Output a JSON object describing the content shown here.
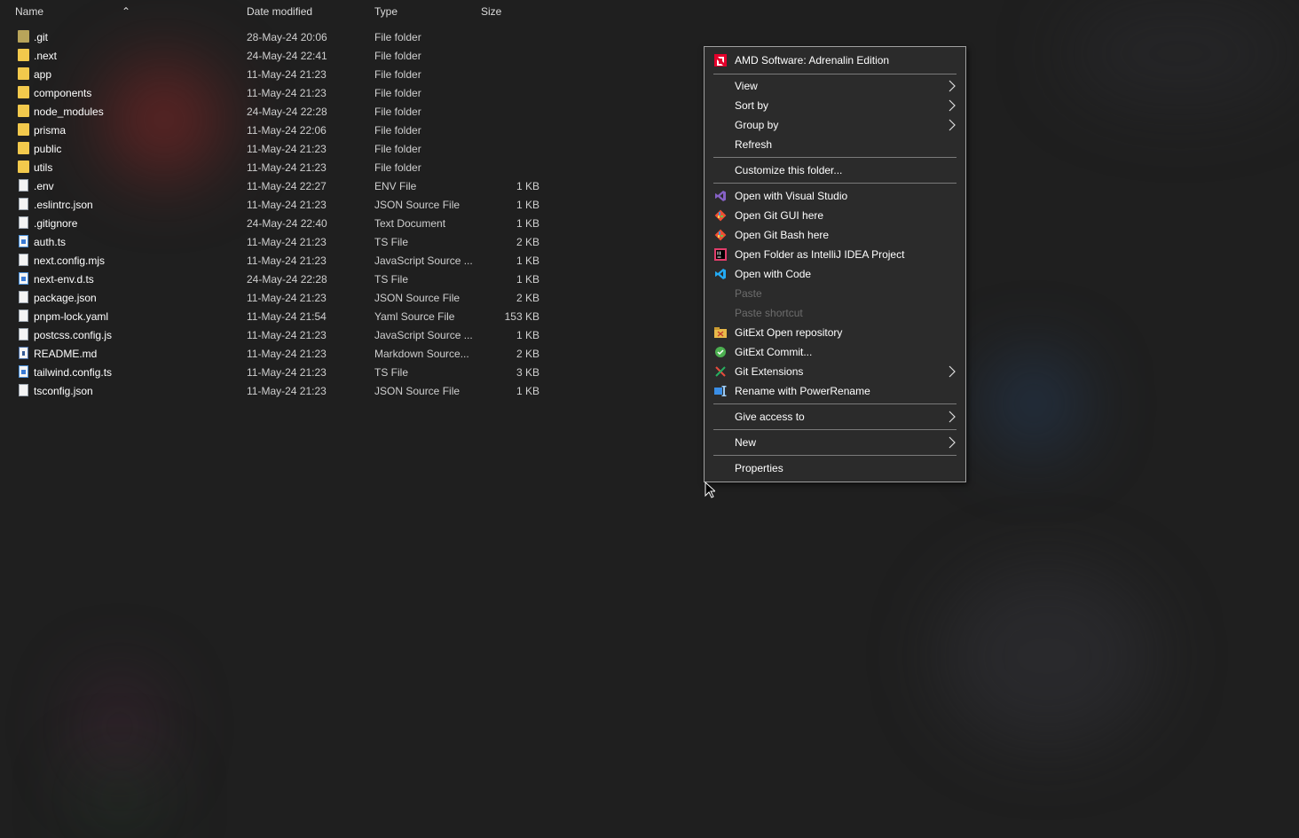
{
  "columns": {
    "name": "Name",
    "date": "Date modified",
    "type": "Type",
    "size": "Size"
  },
  "files": [
    {
      "name": ".git",
      "date": "28-May-24 20:06",
      "type": "File folder",
      "size": "",
      "icon": "folder-icon"
    },
    {
      "name": ".next",
      "date": "24-May-24 22:41",
      "type": "File folder",
      "size": "",
      "icon": "folder-icon"
    },
    {
      "name": "app",
      "date": "11-May-24 21:23",
      "type": "File folder",
      "size": "",
      "icon": "folder-icon"
    },
    {
      "name": "components",
      "date": "11-May-24 21:23",
      "type": "File folder",
      "size": "",
      "icon": "folder-icon"
    },
    {
      "name": "node_modules",
      "date": "24-May-24 22:28",
      "type": "File folder",
      "size": "",
      "icon": "folder-icon"
    },
    {
      "name": "prisma",
      "date": "11-May-24 22:06",
      "type": "File folder",
      "size": "",
      "icon": "folder-icon"
    },
    {
      "name": "public",
      "date": "11-May-24 21:23",
      "type": "File folder",
      "size": "",
      "icon": "folder-icon"
    },
    {
      "name": "utils",
      "date": "11-May-24 21:23",
      "type": "File folder",
      "size": "",
      "icon": "folder-icon"
    },
    {
      "name": ".env",
      "date": "11-May-24 22:27",
      "type": "ENV File",
      "size": "1 KB",
      "icon": "file-icon"
    },
    {
      "name": ".eslintrc.json",
      "date": "11-May-24 21:23",
      "type": "JSON Source File",
      "size": "1 KB",
      "icon": "json-file-icon"
    },
    {
      "name": ".gitignore",
      "date": "24-May-24 22:40",
      "type": "Text Document",
      "size": "1 KB",
      "icon": "text-file-icon"
    },
    {
      "name": "auth.ts",
      "date": "11-May-24 21:23",
      "type": "TS File",
      "size": "2 KB",
      "icon": "ts-file-icon"
    },
    {
      "name": "next.config.mjs",
      "date": "11-May-24 21:23",
      "type": "JavaScript Source ...",
      "size": "1 KB",
      "icon": "js-file-icon"
    },
    {
      "name": "next-env.d.ts",
      "date": "24-May-24 22:28",
      "type": "TS File",
      "size": "1 KB",
      "icon": "ts-file-icon"
    },
    {
      "name": "package.json",
      "date": "11-May-24 21:23",
      "type": "JSON Source File",
      "size": "2 KB",
      "icon": "json-file-icon"
    },
    {
      "name": "pnpm-lock.yaml",
      "date": "11-May-24 21:54",
      "type": "Yaml Source File",
      "size": "153 KB",
      "icon": "yaml-file-icon"
    },
    {
      "name": "postcss.config.js",
      "date": "11-May-24 21:23",
      "type": "JavaScript Source ...",
      "size": "1 KB",
      "icon": "js-file-icon"
    },
    {
      "name": "README.md",
      "date": "11-May-24 21:23",
      "type": "Markdown Source...",
      "size": "2 KB",
      "icon": "markdown-file-icon"
    },
    {
      "name": "tailwind.config.ts",
      "date": "11-May-24 21:23",
      "type": "TS File",
      "size": "3 KB",
      "icon": "ts-file-icon"
    },
    {
      "name": "tsconfig.json",
      "date": "11-May-24 21:23",
      "type": "JSON Source File",
      "size": "1 KB",
      "icon": "json-file-icon"
    }
  ],
  "context_menu": {
    "amd": "AMD Software: Adrenalin Edition",
    "view": "View",
    "sort_by": "Sort by",
    "group_by": "Group by",
    "refresh": "Refresh",
    "customize": "Customize this folder...",
    "open_vs": "Open with Visual Studio",
    "git_gui": "Open Git GUI here",
    "git_bash": "Open Git Bash here",
    "intellij": "Open Folder as IntelliJ IDEA Project",
    "open_code": "Open with Code",
    "paste": "Paste",
    "paste_shortcut": "Paste shortcut",
    "gitext_open": "GitExt Open repository",
    "gitext_commit": "GitExt Commit...",
    "git_extensions": "Git Extensions",
    "powerrename": "Rename with PowerRename",
    "give_access": "Give access to",
    "new": "New",
    "properties": "Properties"
  },
  "colors": {
    "folder": "#f2c94c",
    "menu_bg": "#2b2b2b",
    "amd_red": "#e4002b",
    "vs_purple": "#8661c5",
    "vscode_blue": "#23a9f2",
    "git_orange": "#f05033"
  }
}
